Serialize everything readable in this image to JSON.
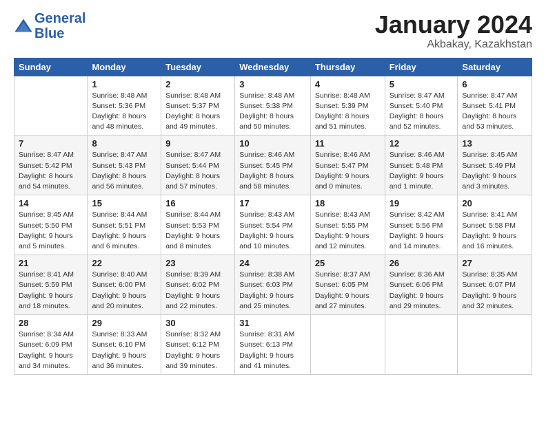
{
  "header": {
    "logo_text_general": "General",
    "logo_text_blue": "Blue",
    "month_title": "January 2024",
    "location": "Akbakay, Kazakhstan"
  },
  "weekdays": [
    "Sunday",
    "Monday",
    "Tuesday",
    "Wednesday",
    "Thursday",
    "Friday",
    "Saturday"
  ],
  "weeks": [
    [
      {
        "day": "",
        "sunrise": "",
        "sunset": "",
        "daylight": ""
      },
      {
        "day": "1",
        "sunrise": "Sunrise: 8:48 AM",
        "sunset": "Sunset: 5:36 PM",
        "daylight": "Daylight: 8 hours and 48 minutes."
      },
      {
        "day": "2",
        "sunrise": "Sunrise: 8:48 AM",
        "sunset": "Sunset: 5:37 PM",
        "daylight": "Daylight: 8 hours and 49 minutes."
      },
      {
        "day": "3",
        "sunrise": "Sunrise: 8:48 AM",
        "sunset": "Sunset: 5:38 PM",
        "daylight": "Daylight: 8 hours and 50 minutes."
      },
      {
        "day": "4",
        "sunrise": "Sunrise: 8:48 AM",
        "sunset": "Sunset: 5:39 PM",
        "daylight": "Daylight: 8 hours and 51 minutes."
      },
      {
        "day": "5",
        "sunrise": "Sunrise: 8:47 AM",
        "sunset": "Sunset: 5:40 PM",
        "daylight": "Daylight: 8 hours and 52 minutes."
      },
      {
        "day": "6",
        "sunrise": "Sunrise: 8:47 AM",
        "sunset": "Sunset: 5:41 PM",
        "daylight": "Daylight: 8 hours and 53 minutes."
      }
    ],
    [
      {
        "day": "7",
        "sunrise": "Sunrise: 8:47 AM",
        "sunset": "Sunset: 5:42 PM",
        "daylight": "Daylight: 8 hours and 54 minutes."
      },
      {
        "day": "8",
        "sunrise": "Sunrise: 8:47 AM",
        "sunset": "Sunset: 5:43 PM",
        "daylight": "Daylight: 8 hours and 56 minutes."
      },
      {
        "day": "9",
        "sunrise": "Sunrise: 8:47 AM",
        "sunset": "Sunset: 5:44 PM",
        "daylight": "Daylight: 8 hours and 57 minutes."
      },
      {
        "day": "10",
        "sunrise": "Sunrise: 8:46 AM",
        "sunset": "Sunset: 5:45 PM",
        "daylight": "Daylight: 8 hours and 58 minutes."
      },
      {
        "day": "11",
        "sunrise": "Sunrise: 8:46 AM",
        "sunset": "Sunset: 5:47 PM",
        "daylight": "Daylight: 9 hours and 0 minutes."
      },
      {
        "day": "12",
        "sunrise": "Sunrise: 8:46 AM",
        "sunset": "Sunset: 5:48 PM",
        "daylight": "Daylight: 9 hours and 1 minute."
      },
      {
        "day": "13",
        "sunrise": "Sunrise: 8:45 AM",
        "sunset": "Sunset: 5:49 PM",
        "daylight": "Daylight: 9 hours and 3 minutes."
      }
    ],
    [
      {
        "day": "14",
        "sunrise": "Sunrise: 8:45 AM",
        "sunset": "Sunset: 5:50 PM",
        "daylight": "Daylight: 9 hours and 5 minutes."
      },
      {
        "day": "15",
        "sunrise": "Sunrise: 8:44 AM",
        "sunset": "Sunset: 5:51 PM",
        "daylight": "Daylight: 9 hours and 6 minutes."
      },
      {
        "day": "16",
        "sunrise": "Sunrise: 8:44 AM",
        "sunset": "Sunset: 5:53 PM",
        "daylight": "Daylight: 9 hours and 8 minutes."
      },
      {
        "day": "17",
        "sunrise": "Sunrise: 8:43 AM",
        "sunset": "Sunset: 5:54 PM",
        "daylight": "Daylight: 9 hours and 10 minutes."
      },
      {
        "day": "18",
        "sunrise": "Sunrise: 8:43 AM",
        "sunset": "Sunset: 5:55 PM",
        "daylight": "Daylight: 9 hours and 12 minutes."
      },
      {
        "day": "19",
        "sunrise": "Sunrise: 8:42 AM",
        "sunset": "Sunset: 5:56 PM",
        "daylight": "Daylight: 9 hours and 14 minutes."
      },
      {
        "day": "20",
        "sunrise": "Sunrise: 8:41 AM",
        "sunset": "Sunset: 5:58 PM",
        "daylight": "Daylight: 9 hours and 16 minutes."
      }
    ],
    [
      {
        "day": "21",
        "sunrise": "Sunrise: 8:41 AM",
        "sunset": "Sunset: 5:59 PM",
        "daylight": "Daylight: 9 hours and 18 minutes."
      },
      {
        "day": "22",
        "sunrise": "Sunrise: 8:40 AM",
        "sunset": "Sunset: 6:00 PM",
        "daylight": "Daylight: 9 hours and 20 minutes."
      },
      {
        "day": "23",
        "sunrise": "Sunrise: 8:39 AM",
        "sunset": "Sunset: 6:02 PM",
        "daylight": "Daylight: 9 hours and 22 minutes."
      },
      {
        "day": "24",
        "sunrise": "Sunrise: 8:38 AM",
        "sunset": "Sunset: 6:03 PM",
        "daylight": "Daylight: 9 hours and 25 minutes."
      },
      {
        "day": "25",
        "sunrise": "Sunrise: 8:37 AM",
        "sunset": "Sunset: 6:05 PM",
        "daylight": "Daylight: 9 hours and 27 minutes."
      },
      {
        "day": "26",
        "sunrise": "Sunrise: 8:36 AM",
        "sunset": "Sunset: 6:06 PM",
        "daylight": "Daylight: 9 hours and 29 minutes."
      },
      {
        "day": "27",
        "sunrise": "Sunrise: 8:35 AM",
        "sunset": "Sunset: 6:07 PM",
        "daylight": "Daylight: 9 hours and 32 minutes."
      }
    ],
    [
      {
        "day": "28",
        "sunrise": "Sunrise: 8:34 AM",
        "sunset": "Sunset: 6:09 PM",
        "daylight": "Daylight: 9 hours and 34 minutes."
      },
      {
        "day": "29",
        "sunrise": "Sunrise: 8:33 AM",
        "sunset": "Sunset: 6:10 PM",
        "daylight": "Daylight: 9 hours and 36 minutes."
      },
      {
        "day": "30",
        "sunrise": "Sunrise: 8:32 AM",
        "sunset": "Sunset: 6:12 PM",
        "daylight": "Daylight: 9 hours and 39 minutes."
      },
      {
        "day": "31",
        "sunrise": "Sunrise: 8:31 AM",
        "sunset": "Sunset: 6:13 PM",
        "daylight": "Daylight: 9 hours and 41 minutes."
      },
      {
        "day": "",
        "sunrise": "",
        "sunset": "",
        "daylight": ""
      },
      {
        "day": "",
        "sunrise": "",
        "sunset": "",
        "daylight": ""
      },
      {
        "day": "",
        "sunrise": "",
        "sunset": "",
        "daylight": ""
      }
    ]
  ]
}
